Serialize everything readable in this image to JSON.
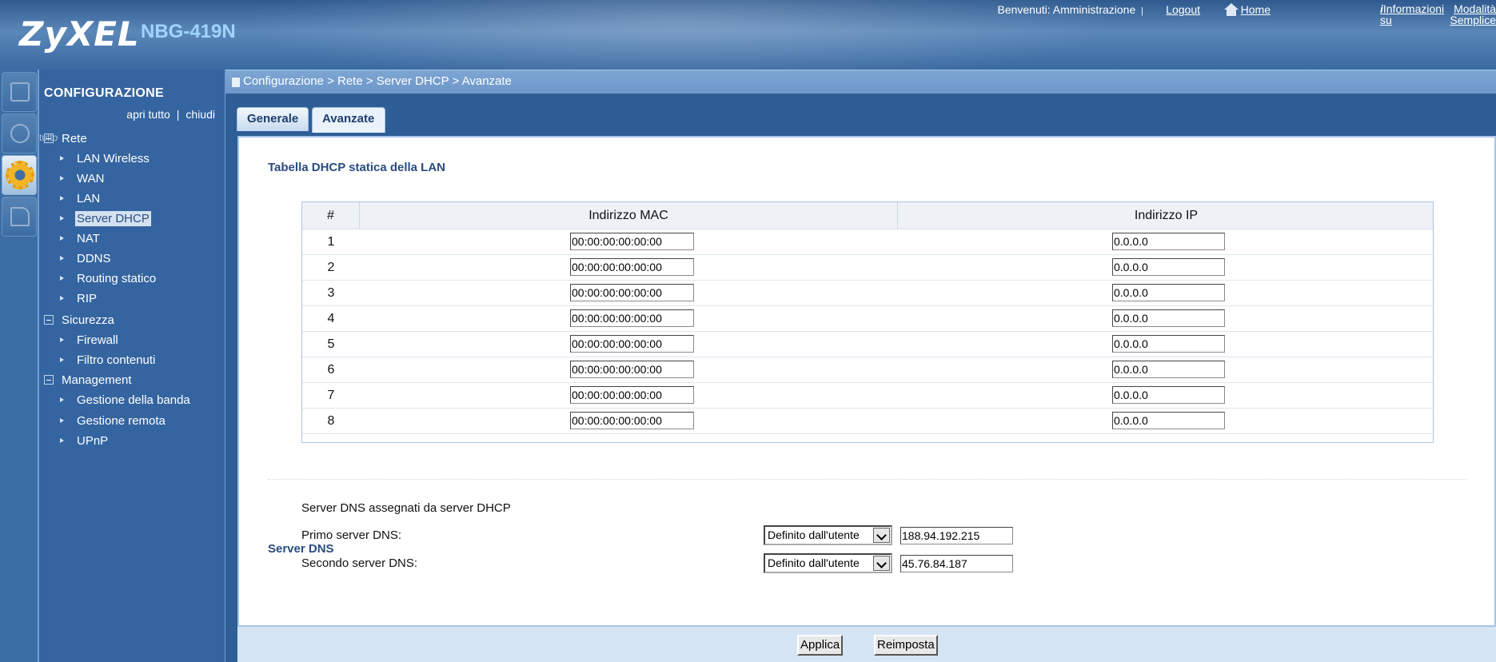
{
  "header": {
    "brand": "ZyXEL",
    "model": "NBG-419N",
    "welcome": "Benvenuti: Amministrazione",
    "sep": "|",
    "logout": "Logout",
    "home": "Home",
    "info_line1": "Informazioni",
    "info_line2": "su",
    "mode_line1": "Modalità",
    "mode_line2": "Semplice"
  },
  "sidebar": {
    "title": "CONFIGURAZIONE",
    "open_all": "apri tutto",
    "sep": "|",
    "close": "chiudi",
    "tutto_overlay": "tutto",
    "groups": [
      {
        "label": "Rete"
      },
      {
        "label": "Sicurezza"
      },
      {
        "label": "Management"
      }
    ],
    "items": [
      {
        "label": "LAN Wireless"
      },
      {
        "label": "WAN"
      },
      {
        "label": "LAN"
      },
      {
        "label": "Server DHCP"
      },
      {
        "label": "NAT"
      },
      {
        "label": "DDNS"
      },
      {
        "label": "Routing statico"
      },
      {
        "label": "RIP"
      },
      {
        "label": "Firewall"
      },
      {
        "label": "Filtro contenuti"
      },
      {
        "label": "Gestione della banda"
      },
      {
        "label": "Gestione remota"
      },
      {
        "label": "UPnP"
      }
    ]
  },
  "breadcrumb": "Configurazione > Rete > Server DHCP > Avanzate",
  "tabs": [
    {
      "label": "Generale"
    },
    {
      "label": "Avanzate"
    }
  ],
  "dhcp": {
    "title": "Tabella DHCP statica della LAN",
    "columns": [
      "#",
      "Indirizzo MAC",
      "Indirizzo IP"
    ],
    "rows": [
      {
        "num": "1",
        "mac": "00:00:00:00:00:00",
        "ip": "0.0.0.0"
      },
      {
        "num": "2",
        "mac": "00:00:00:00:00:00",
        "ip": "0.0.0.0"
      },
      {
        "num": "3",
        "mac": "00:00:00:00:00:00",
        "ip": "0.0.0.0"
      },
      {
        "num": "4",
        "mac": "00:00:00:00:00:00",
        "ip": "0.0.0.0"
      },
      {
        "num": "5",
        "mac": "00:00:00:00:00:00",
        "ip": "0.0.0.0"
      },
      {
        "num": "6",
        "mac": "00:00:00:00:00:00",
        "ip": "0.0.0.0"
      },
      {
        "num": "7",
        "mac": "00:00:00:00:00:00",
        "ip": "0.0.0.0"
      },
      {
        "num": "8",
        "mac": "00:00:00:00:00:00",
        "ip": "0.0.0.0"
      }
    ]
  },
  "dns": {
    "title": "Server DNS",
    "assigned_text": "Server DNS assegnati da server DHCP",
    "primary_label": "Primo server DNS:",
    "primary_mode": "Definito dall'utente",
    "primary_value": "188.94.192.215",
    "secondary_label": "Secondo server DNS:",
    "secondary_mode": "Definito dall'utente",
    "secondary_value": "45.76.84.187"
  },
  "buttons": {
    "apply": "Applica",
    "reset": "Reimposta"
  },
  "icons": {
    "rail": [
      "monitor-icon",
      "status-icon",
      "configuration-gear-icon",
      "maintenance-icon"
    ],
    "home": "home-icon",
    "info": "info-icon",
    "mode": "mode-icon"
  },
  "colors": {
    "header_blue": "#2e5a8f",
    "sidebar_blue": "#3565a0",
    "title_blue": "#284c80",
    "gear_orange": "#f2b325"
  }
}
